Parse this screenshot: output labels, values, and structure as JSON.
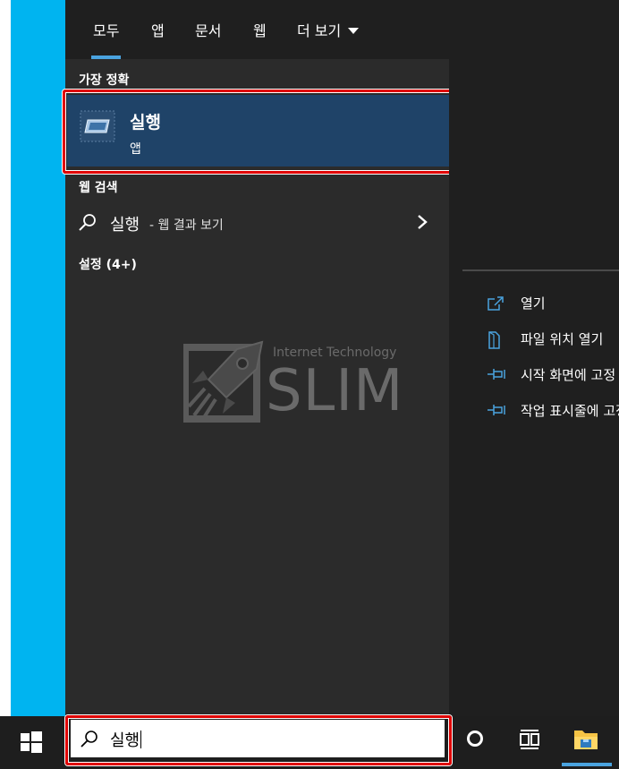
{
  "tabs": [
    {
      "label": "모두",
      "active": true
    },
    {
      "label": "앱",
      "active": false
    },
    {
      "label": "문서",
      "active": false
    },
    {
      "label": "웹",
      "active": false
    },
    {
      "label": "더 보기",
      "active": false
    }
  ],
  "sections": {
    "best_match": "가장 정확",
    "web_search": "웹 검색",
    "settings": "설정 (4+)"
  },
  "best_match_item": {
    "name": "실행",
    "type": "앱"
  },
  "web_result": {
    "term": "실행",
    "suffix": "- 웹 결과 보기"
  },
  "watermark": {
    "small": "Internet Technology",
    "big": "SLIM"
  },
  "actions": [
    {
      "label": "열기",
      "icon": "open-icon"
    },
    {
      "label": "파일 위치 열기",
      "icon": "file-location-icon"
    },
    {
      "label": "시작 화면에 고정",
      "icon": "pin-icon"
    },
    {
      "label": "작업 표시줄에 고정",
      "icon": "pin-icon"
    }
  ],
  "search": {
    "value": "실행"
  },
  "colors": {
    "accent": "#4aa3df",
    "highlight": "#1f4368",
    "annotation": "#e00000"
  }
}
